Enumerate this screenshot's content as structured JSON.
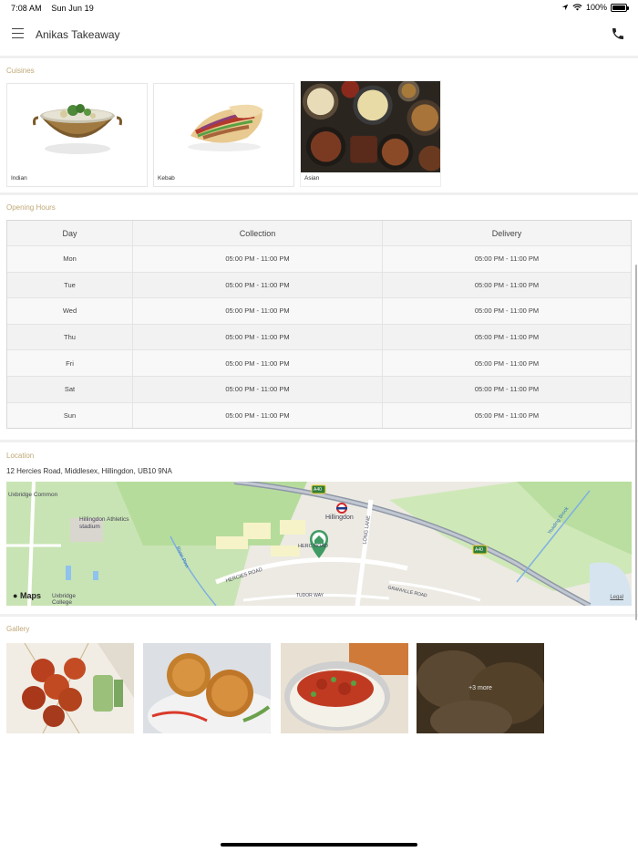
{
  "status_bar": {
    "time": "7:08 AM",
    "date": "Sun Jun 19",
    "battery": "100%"
  },
  "header": {
    "title": "Anikas Takeaway"
  },
  "sections": {
    "cuisines": "Cuisines",
    "opening_hours": "Opening Hours",
    "location": "Location",
    "gallery": "Gallery"
  },
  "cuisines": [
    {
      "label": "Indian"
    },
    {
      "label": "Kebab"
    },
    {
      "label": "Asian"
    }
  ],
  "opening_hours": {
    "columns": [
      "Day",
      "Collection",
      "Delivery"
    ],
    "rows": [
      {
        "day": "Mon",
        "collection": "05:00 PM - 11:00 PM",
        "delivery": "05:00 PM - 11:00 PM"
      },
      {
        "day": "Tue",
        "collection": "05:00 PM - 11:00 PM",
        "delivery": "05:00 PM - 11:00 PM"
      },
      {
        "day": "Wed",
        "collection": "05:00 PM - 11:00 PM",
        "delivery": "05:00 PM - 11:00 PM"
      },
      {
        "day": "Thu",
        "collection": "05:00 PM - 11:00 PM",
        "delivery": "05:00 PM - 11:00 PM"
      },
      {
        "day": "Fri",
        "collection": "05:00 PM - 11:00 PM",
        "delivery": "05:00 PM - 11:00 PM"
      },
      {
        "day": "Sat",
        "collection": "05:00 PM - 11:00 PM",
        "delivery": "05:00 PM - 11:00 PM"
      },
      {
        "day": "Sun",
        "collection": "05:00 PM - 11:00 PM",
        "delivery": "05:00 PM - 11:00 PM"
      }
    ]
  },
  "location": {
    "address": "12 Hercies Road, Middlesex, Hillingdon, UB10 9NA",
    "map": {
      "labels": {
        "uxbridge_common": "Uxbridge Common",
        "hillingdon_athletics": "Hillingdon Athletics",
        "stadium": "stadium",
        "hillingdon": "Hillingdon",
        "hercies_road": "HERCIES ROAD",
        "herc_road": "HERC ROAD",
        "long_lane": "LONG LANE",
        "granville_road": "GRANVILLE ROAD",
        "tudor_way": "TUDOR WAY",
        "river_pinn": "River Pinn",
        "yeading_brook": "Yeading Brook",
        "uxbridge_college": "Uxbridge College",
        "a40_1": "A40",
        "a40_2": "A40"
      },
      "maps_brand": "Maps",
      "legal": "Legal"
    }
  },
  "gallery": {
    "more_label": "+3 more"
  }
}
